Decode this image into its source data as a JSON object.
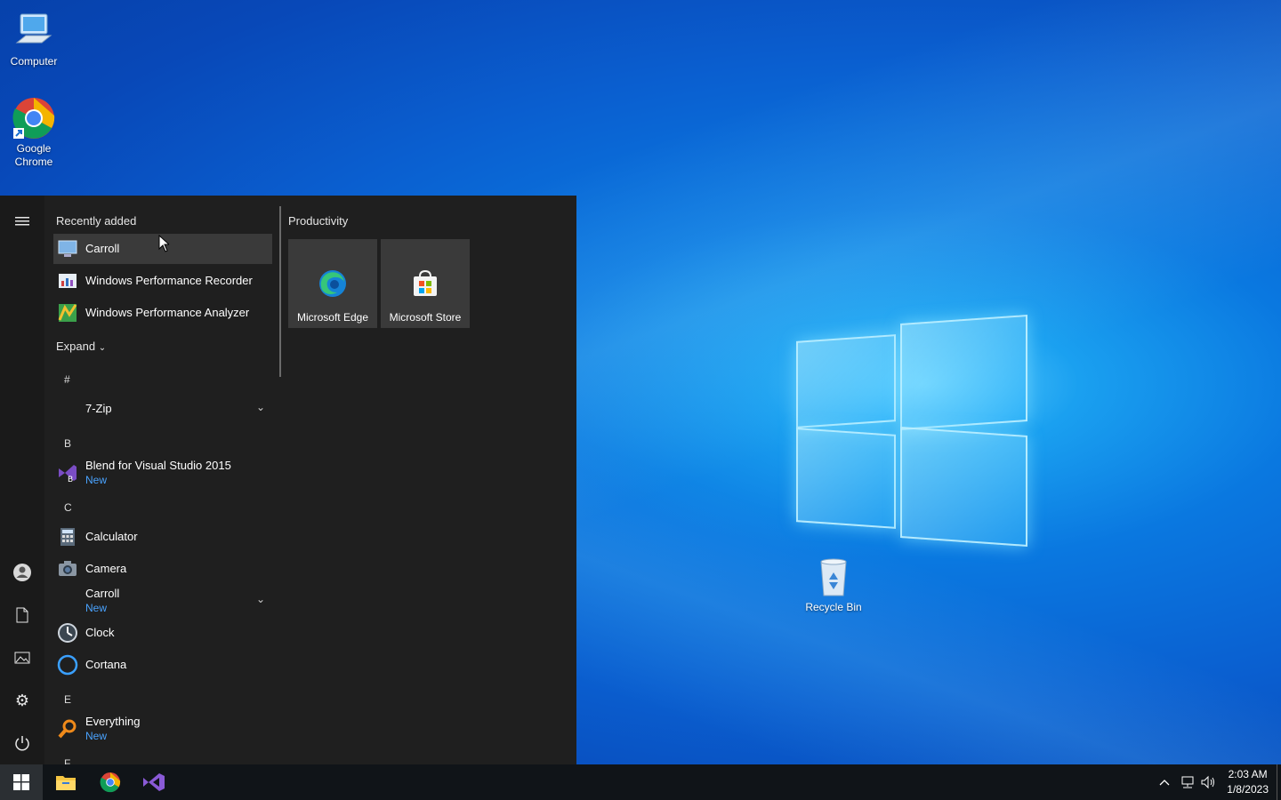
{
  "desktop": {
    "icons": [
      {
        "label": "Computer"
      },
      {
        "label": "Google\nChrome"
      },
      {
        "label": "Recycle Bin"
      }
    ]
  },
  "start_menu": {
    "recently_added_label": "Recently added",
    "recent": [
      {
        "label": "Carroll"
      },
      {
        "label": "Windows Performance Recorder"
      },
      {
        "label": "Windows Performance Analyzer"
      }
    ],
    "expand_label": "Expand",
    "groups": [
      {
        "letter": "#",
        "apps": [
          {
            "label": "7-Zip",
            "expandable": true
          }
        ]
      },
      {
        "letter": "B",
        "apps": [
          {
            "label": "Blend for Visual Studio 2015",
            "badge": "New"
          }
        ]
      },
      {
        "letter": "C",
        "apps": [
          {
            "label": "Calculator"
          },
          {
            "label": "Camera"
          },
          {
            "label": "Carroll",
            "badge": "New",
            "expandable": true
          },
          {
            "label": "Clock"
          },
          {
            "label": "Cortana"
          }
        ]
      },
      {
        "letter": "E",
        "apps": [
          {
            "label": "Everything",
            "badge": "New"
          }
        ]
      },
      {
        "letter": "F",
        "apps": []
      }
    ],
    "tiles_group_label": "Productivity",
    "tiles": [
      {
        "label": "Microsoft Edge"
      },
      {
        "label": "Microsoft Store"
      }
    ]
  },
  "taskbar": {
    "time": "2:03 AM",
    "date": "1/8/2023"
  }
}
